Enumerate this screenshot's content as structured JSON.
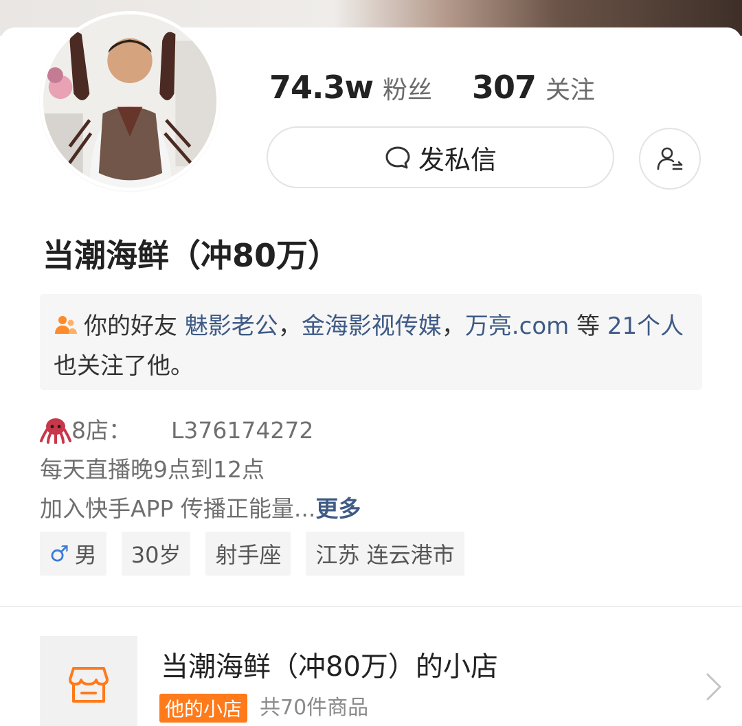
{
  "profile": {
    "fans_count": "74.3w",
    "fans_label": "粉丝",
    "following_count": "307",
    "following_label": "关注",
    "message_button": "发私信",
    "follow_icon": "add-user-icon",
    "name": "当潮海鲜（冲80万）"
  },
  "mutual": {
    "prefix": "你的好友",
    "friends": [
      "魅影老公",
      "金海影视传媒",
      "万亮.com"
    ],
    "separator": "，",
    "etc": "等",
    "count_link": "21个人",
    "suffix": "也关注了他。",
    "icon": "friends-icon",
    "icon_color": "#ff8a2a"
  },
  "bio": {
    "shop_label": "8店：",
    "shop_id": "L376174272",
    "line2": "每天直播晚9点到12点",
    "line3": "加入快手APP  传播正能量...",
    "more": "更多",
    "emoji": "octopus-icon"
  },
  "tags": {
    "gender_symbol": "♂",
    "gender": "男",
    "age": "30岁",
    "zodiac": "射手座",
    "location": "江苏 连云港市"
  },
  "shop": {
    "title": "当潮海鲜（冲80万）的小店",
    "badge": "他的小店",
    "count": "共70件商品",
    "icon": "store-icon",
    "accent_color": "#ff7a1a"
  },
  "colors": {
    "link": "#3e5a85",
    "gender": "#3b7bd8"
  }
}
